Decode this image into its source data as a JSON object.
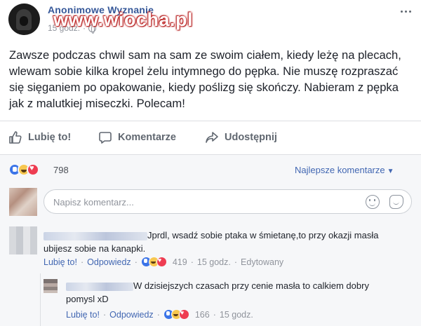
{
  "post": {
    "page_name": "Anonimowe Wyznanie",
    "time": "15 godz.",
    "watermark": "www.wiocha.pl",
    "privacy_icon": "globe-icon",
    "more_icon": "more-options-icon",
    "text": "Zawsze podczas chwil sam na sam ze swoim ciałem, kiedy leżę na plecach, wlewam sobie kilka kropel żelu intymnego do pępka. Nie muszę rozpraszać się sięganiem po opakowanie, kiedy poślizg się skończy. Nabieram z pępka jak z malutkiej miseczki. Polecam!"
  },
  "actions": {
    "like": "Lubię to!",
    "comment": "Komentarze",
    "share": "Udostępnij"
  },
  "reactions": {
    "icons": [
      "like",
      "haha",
      "love"
    ],
    "count": "798",
    "sort_label": "Najlepsze komentarze",
    "sort_icon": "caret-down-icon"
  },
  "composer": {
    "placeholder": "Napisz komentarz...",
    "emoji_icon": "emoji-icon",
    "sticker_icon": "sticker-icon"
  },
  "comments": [
    {
      "text": "Jprdl, wsadź sobie ptaka w śmietanę,to przy okazji masła ubijesz sobie na kanapki.",
      "like": "Lubię to!",
      "reply": "Odpowiedz",
      "reaction_count": "419",
      "time": "15 godz.",
      "edited": "Edytowany",
      "sep": "·"
    },
    {
      "text": "W dzisiejszych czasach przy cenie masła to calkiem dobry pomysl xD",
      "like": "Lubię to!",
      "reply": "Odpowiedz",
      "reaction_count": "166",
      "time": "15 godz.",
      "sep": "·"
    }
  ],
  "colors": {
    "link": "#4267b2",
    "page_name": "#365899",
    "secondary_text": "#90949c",
    "like_reaction": "#3b74e8",
    "haha_reaction": "#f7c74f",
    "love_reaction": "#ee3d52",
    "watermark": "#c82828"
  }
}
